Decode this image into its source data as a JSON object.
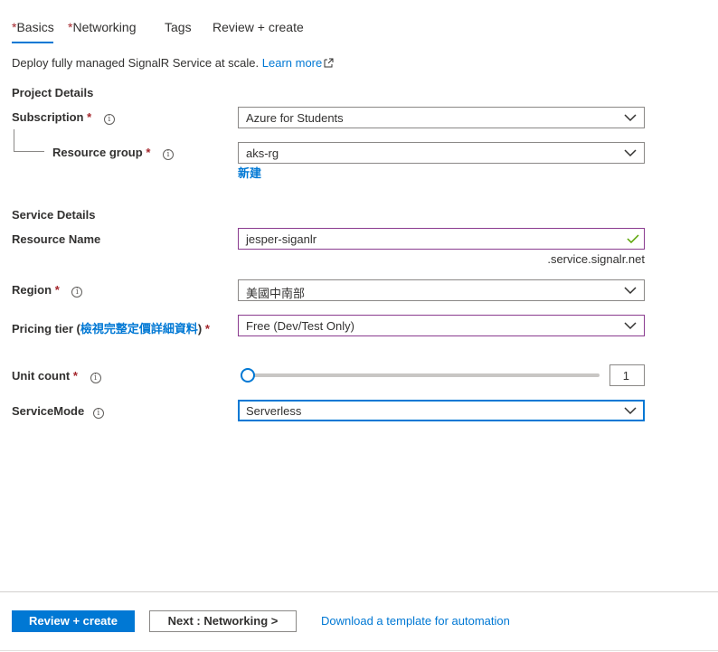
{
  "tabs": [
    {
      "label": "Basics",
      "required": true
    },
    {
      "label": "Networking",
      "required": true
    },
    {
      "label": "Tags",
      "required": false
    },
    {
      "label": "Review + create",
      "required": false
    }
  ],
  "description": {
    "text": "Deploy fully managed SignalR Service at scale.",
    "link": "Learn more"
  },
  "project_details": {
    "title": "Project Details",
    "subscription": {
      "label": "Subscription",
      "value": "Azure for Students"
    },
    "resource_group": {
      "label": "Resource group",
      "value": "aks-rg",
      "create_new": "新建"
    }
  },
  "service_details": {
    "title": "Service Details",
    "resource_name": {
      "label": "Resource Name",
      "value": "jesper-siganlr",
      "suffix": ".service.signalr.net"
    },
    "region": {
      "label": "Region",
      "value": "美國中南部"
    },
    "pricing_tier": {
      "label_prefix": "Pricing tier (",
      "label_link": "檢視完整定價詳細資料",
      "label_suffix": ")",
      "value": "Free (Dev/Test Only)"
    },
    "unit_count": {
      "label": "Unit count",
      "value": "1",
      "slider_fraction": 0
    },
    "service_mode": {
      "label": "ServiceMode",
      "value": "Serverless"
    }
  },
  "required_marker": "*",
  "info_glyph": "i",
  "footer": {
    "review_create": "Review + create",
    "next": "Next : Networking >",
    "template_link": "Download a template for automation"
  },
  "colors": {
    "accent": "#0078d4",
    "required": "#a4262c",
    "valid": "#57a300"
  },
  "icons": [
    "external-link-icon",
    "info-icon",
    "chevron-down-icon",
    "checkmark-icon"
  ]
}
